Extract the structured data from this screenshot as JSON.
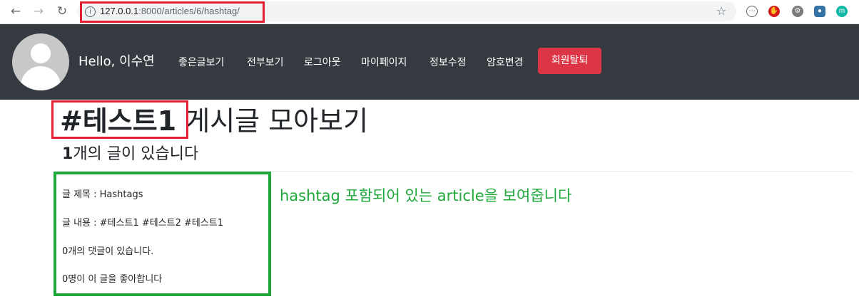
{
  "browser": {
    "url_host": "127.0.0.1",
    "url_rest": ":8000/articles/6/hashtag/"
  },
  "navbar": {
    "greeting": "Hello, 이수연",
    "menu": [
      "좋은글보기",
      "전부보기",
      "로그아웃",
      "마이페이지",
      "정보수정",
      "암호변경"
    ],
    "withdraw_label": "회원탈퇴"
  },
  "main": {
    "title_tag": "#테스트1",
    "title_rest": " 게시글 모아보기",
    "count_number": "1",
    "count_text": "개의 글이 있습니다"
  },
  "article": {
    "title_line": "글 제목 : Hashtags",
    "content_line": "글 내용 : #테스트1 #테스트2 #테스트1",
    "comments_line": "0개의 댓글이 있습니다.",
    "likes_line": "0명이 이 글을 좋아합니다"
  },
  "annotation": {
    "note": "hashtag 포함되어 있는 article을 보여줍니다"
  },
  "colors": {
    "navbar_bg": "#343a40",
    "danger": "#dc3545",
    "highlight_red": "#e02030",
    "highlight_green": "#1fa83a"
  }
}
